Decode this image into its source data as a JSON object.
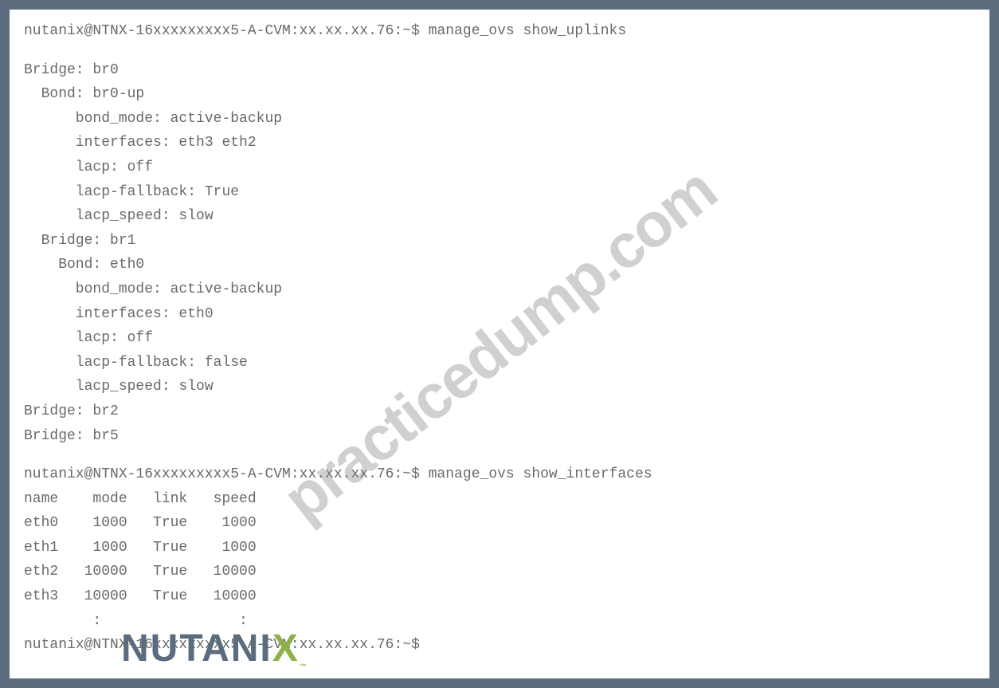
{
  "watermark": "practicedump.com",
  "logo": {
    "prefix": "NUTANI",
    "x": "X",
    "tm": "™"
  },
  "cmd1": {
    "prompt": "nutanix@NTNX-16xxxxxxxxx5-A-CVM:xx.xx.xx.76:~$",
    "command": "manage_ovs show_uplinks"
  },
  "uplinks": {
    "l0": "Bridge: br0",
    "l1": "  Bond: br0-up",
    "l2": "      bond_mode: active-backup",
    "l3": "      interfaces: eth3 eth2",
    "l4": "      lacp: off",
    "l5": "      lacp-fallback: True",
    "l6": "      lacp_speed: slow",
    "l7": "  Bridge: br1",
    "l8": "    Bond: eth0",
    "l9": "      bond_mode: active-backup",
    "l10": "      interfaces: eth0",
    "l11": "      lacp: off",
    "l12": "      lacp-fallback: false",
    "l13": "      lacp_speed: slow",
    "l14": "Bridge: br2",
    "l15": "Bridge: br5"
  },
  "cmd2": {
    "prompt": "nutanix@NTNX-16xxxxxxxxx5-A-CVM:xx.xx.xx.76:~$",
    "command": "manage_ovs show_interfaces"
  },
  "ifaces": {
    "header": "name    mode   link   speed",
    "r0": "eth0    1000   True    1000",
    "r1": "eth1    1000   True    1000",
    "r2": "eth2   10000   True   10000",
    "r3": "eth3   10000   True   10000",
    "r4": "        :                :"
  },
  "cmd3": {
    "prompt": "nutanix@NTNX-16xxxxxxxxx5-A-CVM:xx.xx.xx.76:~$"
  }
}
